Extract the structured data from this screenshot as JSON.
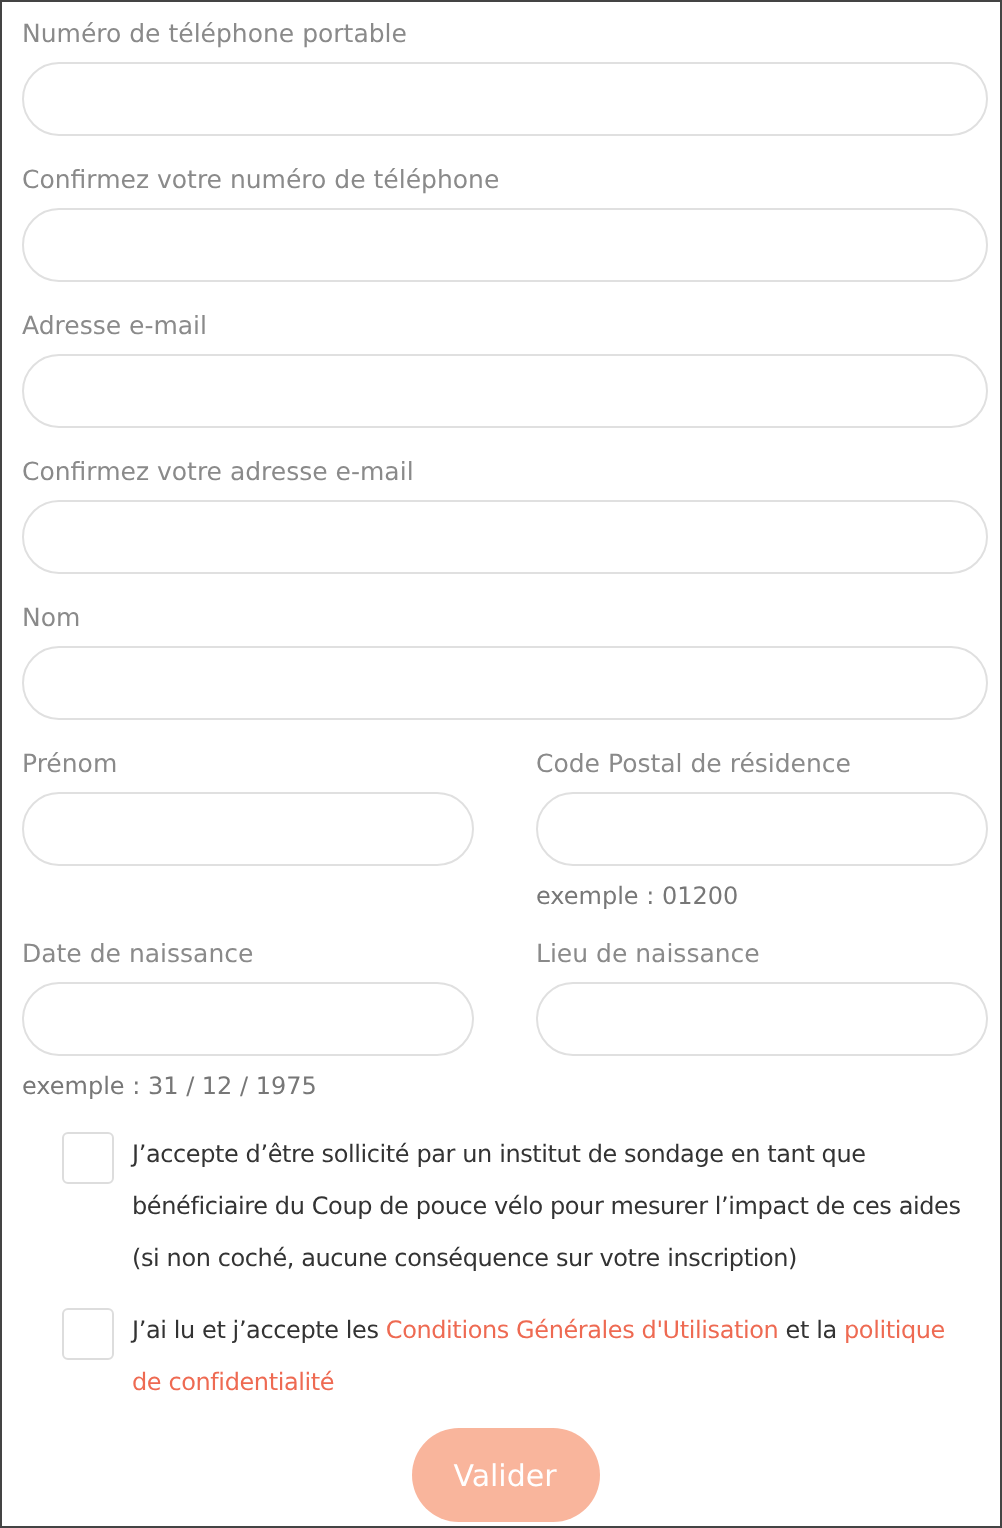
{
  "rows": [
    [
      {
        "label": "Numéro de téléphone portable"
      }
    ],
    [
      {
        "label": "Confirmez votre numéro de téléphone"
      }
    ],
    [
      {
        "label": "Adresse e-mail"
      }
    ],
    [
      {
        "label": "Confirmez votre adresse e-mail"
      }
    ],
    [
      {
        "label": "Nom"
      }
    ],
    [
      {
        "label": "Prénom"
      },
      {
        "label": "Code Postal de résidence",
        "hint": "exemple : 01200"
      }
    ],
    [
      {
        "label": "Date de naissance",
        "hint": "exemple : 31 / 12 / 1975"
      },
      {
        "label": "Lieu de naissance"
      }
    ]
  ],
  "consents": [
    {
      "checked": false,
      "parts": [
        {
          "kind": "text",
          "text": "J’accepte d’être sollicité par un institut de sondage en tant que bénéficiaire du Coup de pouce vélo pour mesurer l’impact de ces aides (si non coché, aucune conséquence sur votre inscription)"
        }
      ]
    },
    {
      "checked": false,
      "parts": [
        {
          "kind": "text",
          "text": "J’ai lu et j’accepte les "
        },
        {
          "kind": "link",
          "text": "Conditions Générales d'Utilisation"
        },
        {
          "kind": "text",
          "text": " et la "
        },
        {
          "kind": "link",
          "text": "politique"
        },
        {
          "kind": "link",
          "text": "de confidentialité"
        }
      ]
    }
  ],
  "submit": {
    "label": "Valider",
    "disabled": true
  }
}
